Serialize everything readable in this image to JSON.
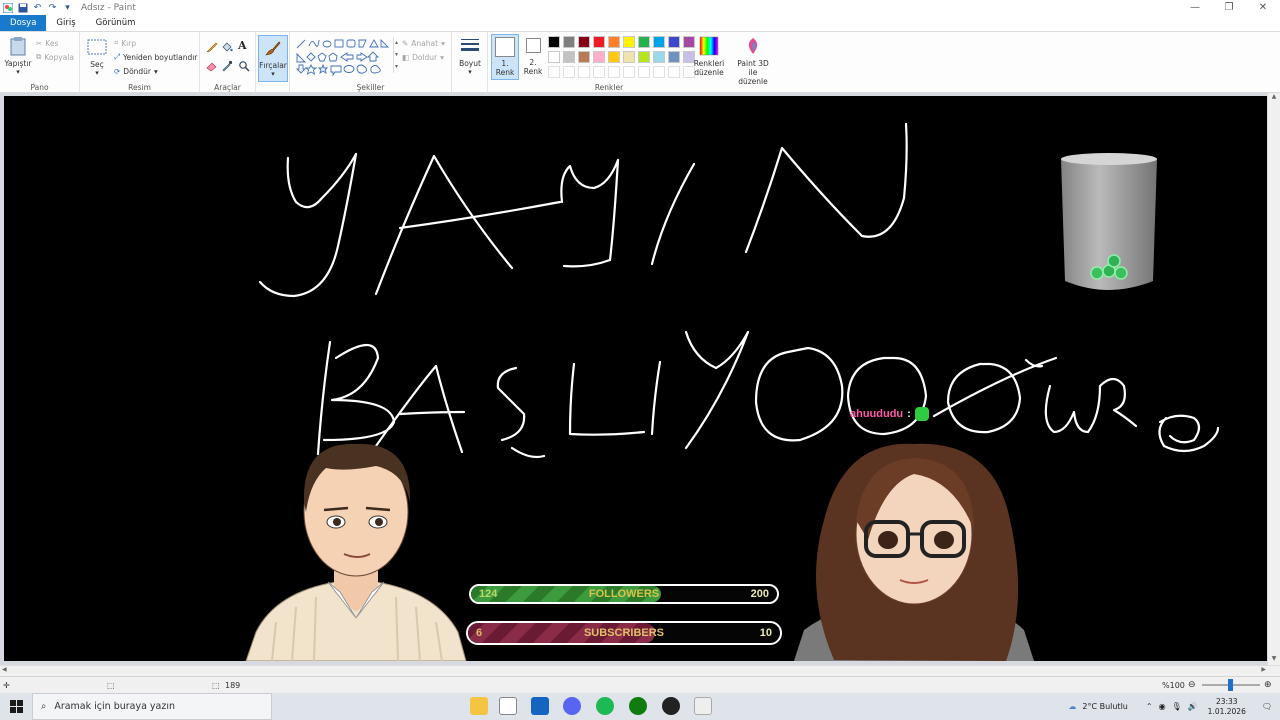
{
  "window": {
    "title": "Adsız - Paint",
    "controls": [
      "minimize-icon",
      "restore-icon",
      "close-icon"
    ]
  },
  "quick_access": [
    "save-icon",
    "undo-icon",
    "redo-icon",
    "customize-icon"
  ],
  "tabs": [
    {
      "label": "Dosya",
      "active": true
    },
    {
      "label": "Giriş",
      "active": false
    },
    {
      "label": "Görünüm",
      "active": false
    }
  ],
  "ribbon": {
    "pano": {
      "label": "Pano",
      "paste": "Yapıştır",
      "cut": "Kes",
      "copy": "Kopyala"
    },
    "resim": {
      "label": "Resim",
      "select": "Seç",
      "crop": "Kırp",
      "resize": "Yeniden boyutlandır",
      "rotate": "Döndür"
    },
    "araclar": {
      "label": "Araçlar"
    },
    "brushes": {
      "label": "Fırçalar"
    },
    "sekiller": {
      "label": "Şekiller",
      "outline": "Anahat",
      "fill": "Doldur"
    },
    "size": {
      "label": "Boyut"
    },
    "renkler": {
      "label": "Renkler",
      "color1": "1. Renk",
      "color2": "2. Renk",
      "edit_colors": "Renkleri düzenle",
      "paint3d": "Paint 3D ile düzenle",
      "palette_row1": [
        "#000000",
        "#7f7f7f",
        "#880015",
        "#ed1c24",
        "#ff7f27",
        "#fff200",
        "#22b14c",
        "#00a2e8",
        "#3f48cc",
        "#a349a4"
      ],
      "palette_row2": [
        "#ffffff",
        "#c3c3c3",
        "#b97a57",
        "#ffaec9",
        "#ffc90e",
        "#efe4b0",
        "#b5e61d",
        "#99d9ea",
        "#7092be",
        "#c8bfe7"
      ]
    }
  },
  "overlay": {
    "chat_user": "ahuududu",
    "chat_colon": ":",
    "followers": {
      "current": "124",
      "label": "FOLLOWERS",
      "goal": "200",
      "progress": 0.62
    },
    "subscribers": {
      "current": "6",
      "label": "SUBSCRIBERS",
      "goal": "10",
      "progress": 0.6
    }
  },
  "status": {
    "size_partial": "189",
    "zoom": "%100"
  },
  "taskbar": {
    "search_placeholder": "Aramak için buraya yazın",
    "weather": "2°C  Bulutlu",
    "time": "23:33",
    "date": "1.01.2026"
  }
}
